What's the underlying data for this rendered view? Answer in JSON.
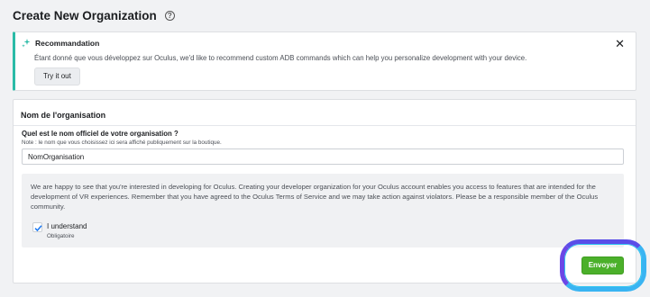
{
  "header": {
    "title": "Create New Organization",
    "help_icon": "question-circle-icon"
  },
  "recommendation": {
    "title": "Recommandation",
    "text": "Étant donné que vous développez sur Oculus, we'd like to recommend custom ADB commands which can help you personalize development with your device.",
    "button_label": "Try it out",
    "close_icon": "close-icon",
    "accent_color": "#2abba7"
  },
  "org_form": {
    "section_title": "Nom de l'organisation",
    "question_label": "Quel est le nom officiel de votre organisation ?",
    "question_note": "Note : le nom que vous choisissez ici sera affiché publiquement sur la boutique.",
    "name_value": "NomOrganisation",
    "terms_text": "We are happy to see that you're interested in developing for Oculus. Creating your developer organization for your Oculus account enables you access to features that are intended for the development of VR experiences. Remember that you have agreed to the Oculus Terms of Service and we may take action against violators. Please be a responsible member of the Oculus community.",
    "agree_label": "I understand",
    "agree_sublabel": "Obligatoire",
    "agree_checked": true,
    "submit_label": "Envoyer",
    "submit_color": "#4bb02a"
  }
}
